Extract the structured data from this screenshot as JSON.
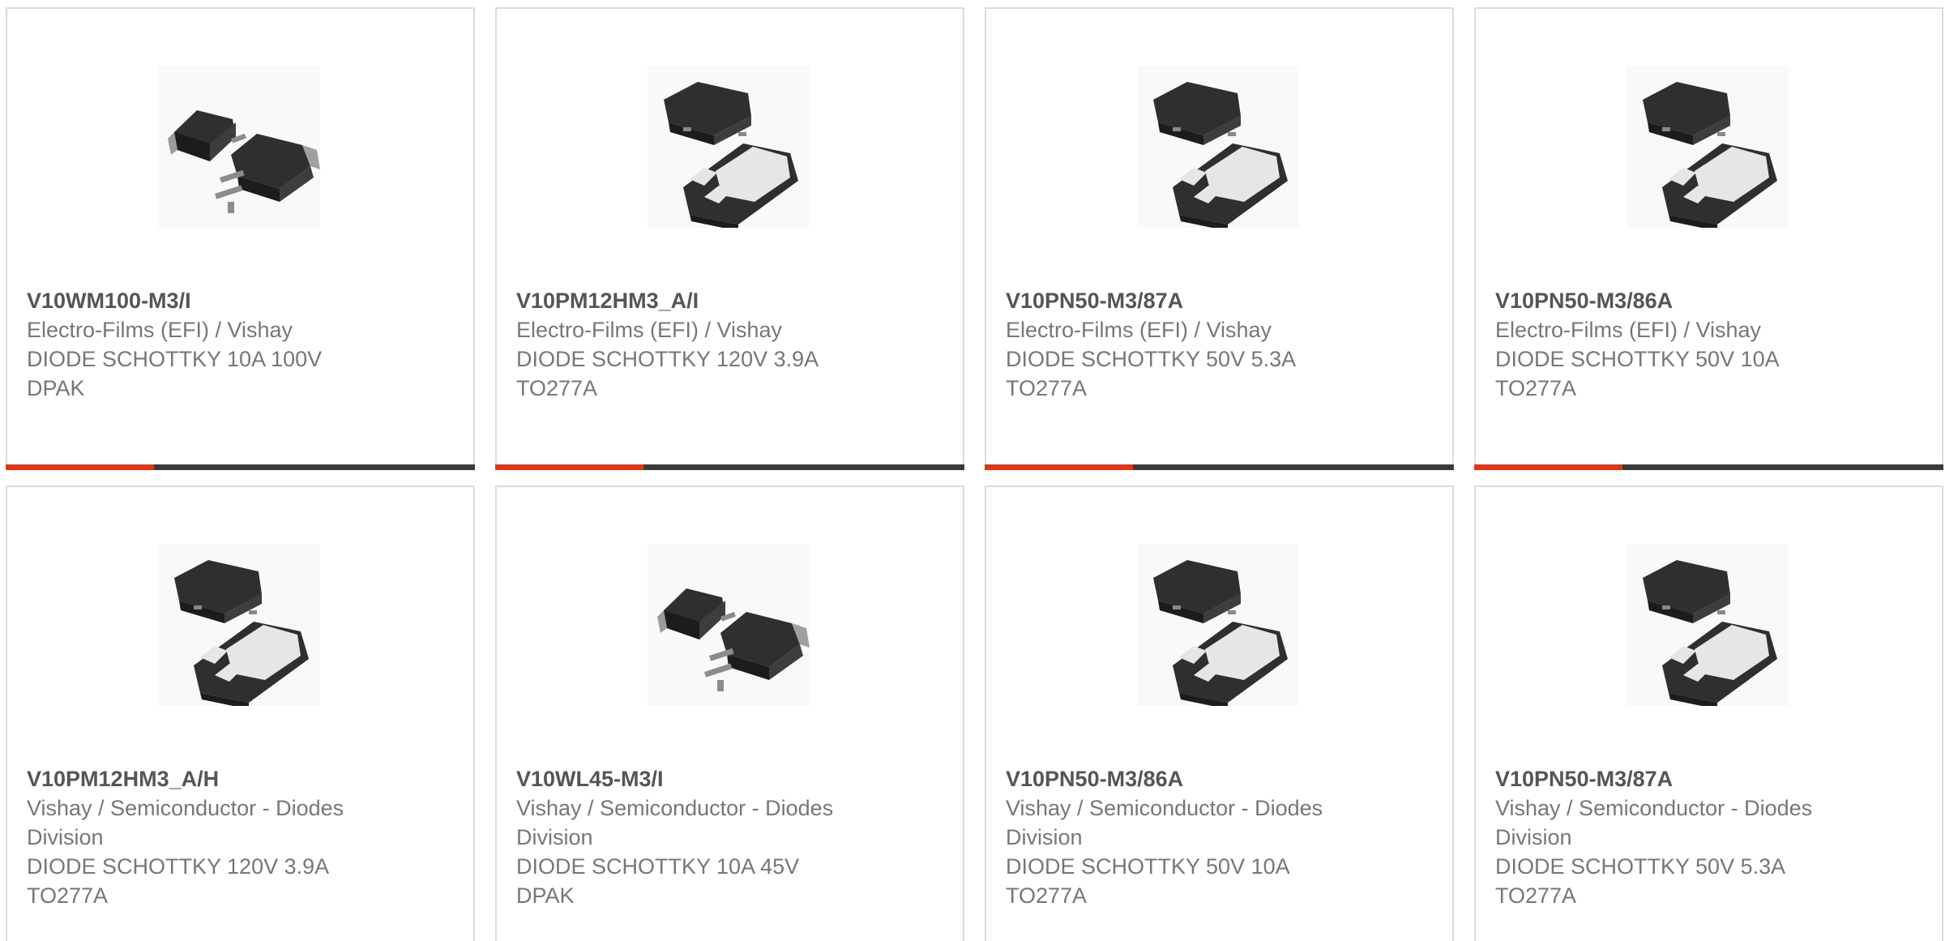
{
  "colors": {
    "accent": "#e63312",
    "bar": "#3a3a3a",
    "border": "#dcdcdc",
    "part_text": "#555555",
    "body_text": "#777777"
  },
  "products": [
    {
      "part": "V10WM100-M3/I",
      "manufacturer": "Electro-Films (EFI) / Vishay",
      "description": "DIODE SCHOTTKY 10A 100V",
      "package": "DPAK",
      "image_icon": "dpak-package-icon"
    },
    {
      "part": "V10PM12HM3_A/I",
      "manufacturer": "Electro-Films (EFI) / Vishay",
      "description": "DIODE SCHOTTKY 120V 3.9A",
      "package": "TO277A",
      "image_icon": "to277a-package-icon"
    },
    {
      "part": "V10PN50-M3/87A",
      "manufacturer": "Electro-Films (EFI) / Vishay",
      "description": "DIODE SCHOTTKY 50V 5.3A",
      "package": "TO277A",
      "image_icon": "to277a-package-icon"
    },
    {
      "part": "V10PN50-M3/86A",
      "manufacturer": "Electro-Films (EFI) / Vishay",
      "description": "DIODE SCHOTTKY 50V 10A",
      "package": "TO277A",
      "image_icon": "to277a-package-icon"
    },
    {
      "part": "V10PM12HM3_A/H",
      "manufacturer": "Vishay / Semiconductor - Diodes Division",
      "description": "DIODE SCHOTTKY 120V 3.9A",
      "package": "TO277A",
      "image_icon": "to277a-package-icon"
    },
    {
      "part": "V10WL45-M3/I",
      "manufacturer": "Vishay / Semiconductor - Diodes Division",
      "description": "DIODE SCHOTTKY 10A 45V",
      "package": "DPAK",
      "image_icon": "dpak-package-icon"
    },
    {
      "part": "V10PN50-M3/86A",
      "manufacturer": "Vishay / Semiconductor - Diodes Division",
      "description": "DIODE SCHOTTKY 50V 10A",
      "package": "TO277A",
      "image_icon": "to277a-package-icon"
    },
    {
      "part": "V10PN50-M3/87A",
      "manufacturer": "Vishay / Semiconductor - Diodes Division",
      "description": "DIODE SCHOTTKY 50V 5.3A",
      "package": "TO277A",
      "image_icon": "to277a-package-icon"
    }
  ]
}
